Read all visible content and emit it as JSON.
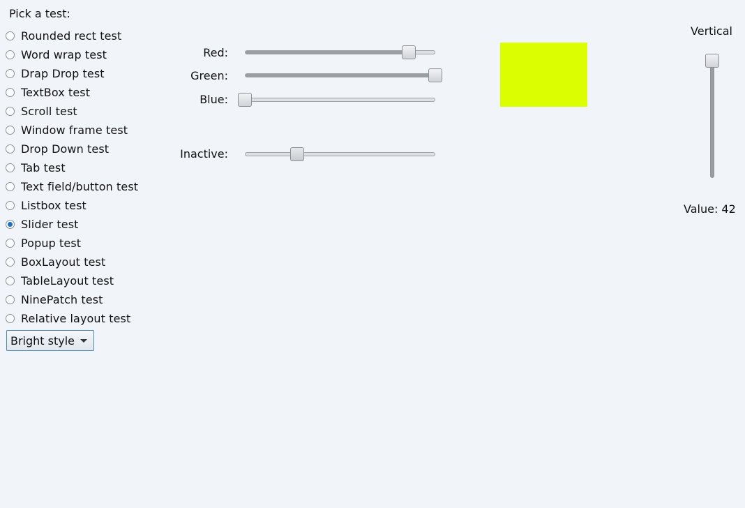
{
  "test_list": {
    "prompt": "Pick a test:",
    "items": [
      {
        "label": "Rounded rect test",
        "checked": false
      },
      {
        "label": "Word wrap test",
        "checked": false
      },
      {
        "label": "Drap Drop test",
        "checked": false
      },
      {
        "label": "TextBox test",
        "checked": false
      },
      {
        "label": "Scroll test",
        "checked": false
      },
      {
        "label": "Window frame test",
        "checked": false
      },
      {
        "label": "Drop Down test",
        "checked": false
      },
      {
        "label": "Tab test",
        "checked": false
      },
      {
        "label": "Text field/button test",
        "checked": false
      },
      {
        "label": "Listbox test",
        "checked": false
      },
      {
        "label": "Slider test",
        "checked": true
      },
      {
        "label": "Popup test",
        "checked": false
      },
      {
        "label": "BoxLayout test",
        "checked": false
      },
      {
        "label": "TableLayout test",
        "checked": false
      },
      {
        "label": "NinePatch test",
        "checked": false
      },
      {
        "label": "Relative layout test",
        "checked": false
      }
    ]
  },
  "style_dropdown": {
    "selected": "Bright style"
  },
  "sliders": {
    "red": {
      "label": "Red:",
      "fraction": 0.86
    },
    "green": {
      "label": "Green:",
      "fraction": 1.0
    },
    "blue": {
      "label": "Blue:",
      "fraction": 0.0
    },
    "inactive": {
      "label": "Inactive:",
      "fraction": 0.275
    }
  },
  "color_preview": {
    "color": "#dbff00"
  },
  "vertical_slider": {
    "label": "Vertical",
    "value_text": "Value: 42",
    "fraction": 1.0
  },
  "colors": {
    "background": "#f1f4f9",
    "radio_checked": "#1a6fc4",
    "dropdown_border": "#4a86b8"
  },
  "icons": {
    "dropdown_caret": "chevron-down-icon"
  }
}
